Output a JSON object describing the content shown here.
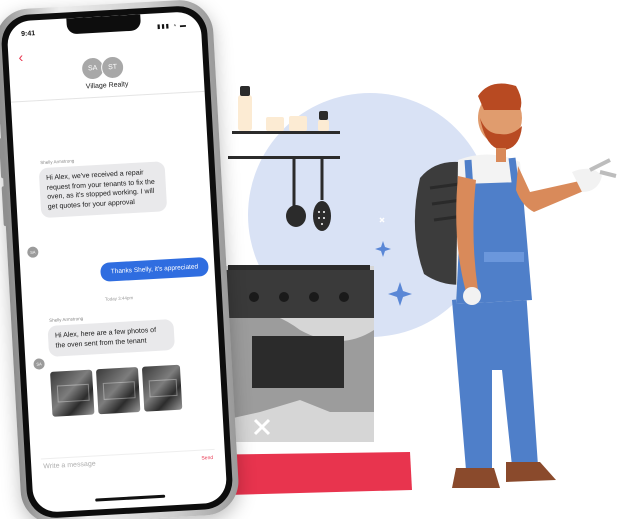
{
  "phone": {
    "status_time": "9:41",
    "status_icons": "▮▮▮ ◔ ▬",
    "back_glyph": "‹",
    "avatars": [
      "SA",
      "ST"
    ],
    "chat_title": "Village Realty",
    "messages": [
      {
        "sender": "Shelly Armstrong",
        "text": "Hi Alex, we've received a repair request from your tenants to fix the oven, as it's stopped working. I will get quotes for your approval"
      },
      {
        "text": "Thanks Shelly, it's appreciated"
      },
      {
        "timestamp": "Today 3:44pm"
      },
      {
        "sender": "Shelly Armstrong",
        "text": "Hi Alex, here are a few photos of the oven sent from the tenant"
      }
    ],
    "incoming_avatar": "SA",
    "compose_placeholder": "Write a message",
    "send_label": "Send"
  },
  "colors": {
    "accent_red": "#e8344e",
    "bubble_blue": "#2f6de0",
    "bubble_gray": "#e9e9eb",
    "circle_blue": "#d9e2f5",
    "oven_dark": "#3a3a3a",
    "overalls_blue": "#4f7fc9"
  },
  "illustration": {
    "icons": [
      "spray-bottle-icon",
      "jar-icon",
      "ladle-icon",
      "skimmer-icon",
      "oven-icon",
      "wrench-icon",
      "sparkle-icon"
    ]
  }
}
